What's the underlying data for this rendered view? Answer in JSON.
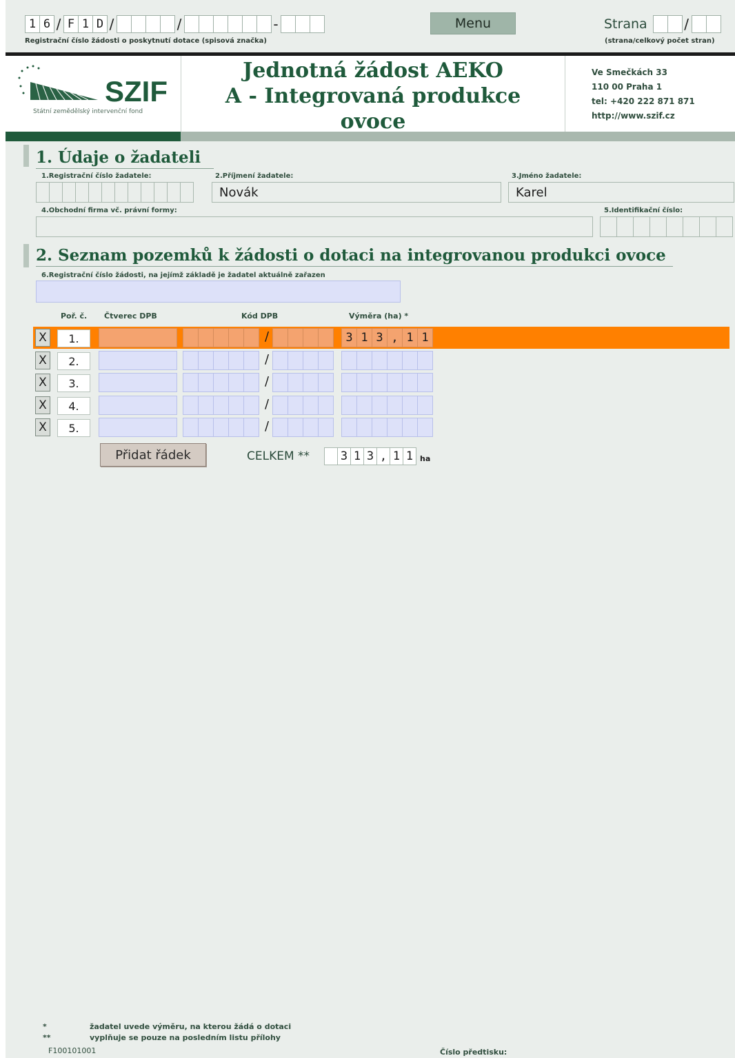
{
  "topbar": {
    "reg_cells": [
      "1",
      "6"
    ],
    "reg_cells2": [
      "F",
      "1",
      "D"
    ],
    "reg_caption": "Registrační číslo žádosti o poskytnutí dotace (spisová značka)",
    "menu_label": "Menu",
    "strana_label": "Strana",
    "strana_caption": "(strana/celkový počet stran)"
  },
  "header": {
    "logo_text": "SZIF",
    "logo_sub": "Státní zemědělský intervenční fond",
    "title_line1": "Jednotná žádost AEKO",
    "title_line2": "A - Integrovaná produkce",
    "title_line3": "ovoce",
    "address": [
      "Ve Smečkách 33",
      "110 00 Praha 1",
      "tel: +420 222 871 871",
      "http://www.szif.cz"
    ]
  },
  "section1": {
    "title": "1. Údaje o žadateli",
    "label_reg": "1.Registrační číslo žadatele:",
    "label_surname": "2.Příjmení žadatele:",
    "label_name": "3.Jméno žadatele:",
    "label_company": "4.Obchodní firma vč. právní formy:",
    "label_ic": "5.Identifikační číslo:",
    "surname": "Novák",
    "name": "Karel"
  },
  "section2": {
    "title": "2. Seznam pozemků k žádosti o dotaci na integrovanou produkci ovoce",
    "label_reg": "6.Registrační číslo žádosti, na jejímž základě je žadatel aktuálně zařazen",
    "col_por": "Poř. č.",
    "col_ctverec": "Čtverec DPB",
    "col_kod": "Kód DPB",
    "col_vymera": "Výměra (ha) *",
    "rows": [
      {
        "x": "X",
        "por": "1.",
        "vymera": [
          "3",
          "1",
          "3",
          ",",
          "1",
          "1"
        ]
      },
      {
        "x": "X",
        "por": "2.",
        "vymera": [
          "",
          "",
          "",
          "",
          "",
          ""
        ]
      },
      {
        "x": "X",
        "por": "3.",
        "vymera": [
          "",
          "",
          "",
          "",
          "",
          ""
        ]
      },
      {
        "x": "X",
        "por": "4.",
        "vymera": [
          "",
          "",
          "",
          "",
          "",
          ""
        ]
      },
      {
        "x": "X",
        "por": "5.",
        "vymera": [
          "",
          "",
          "",
          "",
          "",
          ""
        ]
      }
    ],
    "add_row_label": "Přidat řádek",
    "celkem_label": "CELKEM **",
    "celkem_cells": [
      "",
      "3",
      "1",
      "3",
      ",",
      "1",
      "1"
    ],
    "celkem_unit": "ha"
  },
  "footer": {
    "note1_mark": "*",
    "note1": "žadatel uvede výměru, na kterou žádá o dotaci",
    "note2_mark": "**",
    "note2": "vyplňuje se pouze na posledním listu přílohy",
    "form_code": "F100101001",
    "predtisk_label": "Číslo předtisku:"
  },
  "colors": {
    "brand_green": "#1f5a3b",
    "active_row": "#ff8000",
    "input_blue": "#dde1f9"
  }
}
